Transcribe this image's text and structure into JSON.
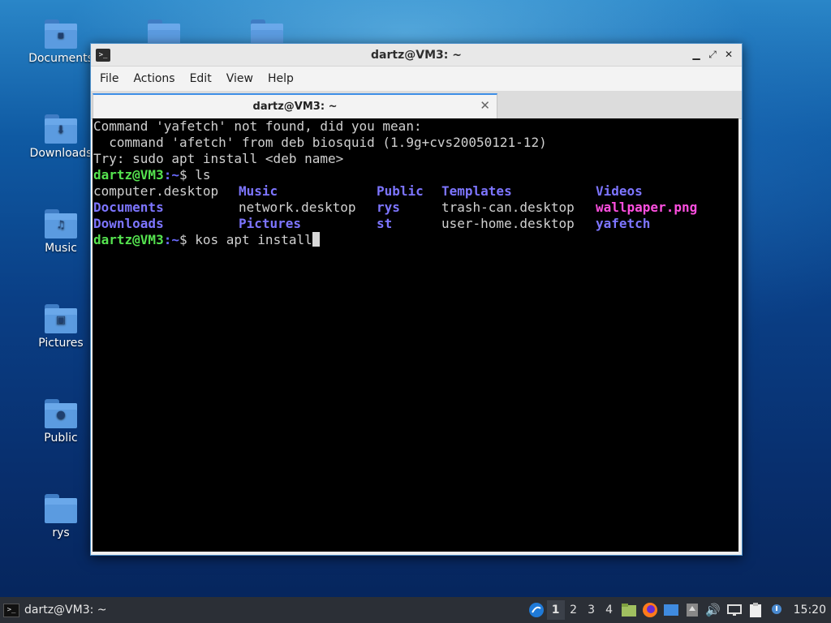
{
  "desktop": {
    "icons": [
      {
        "label": "Documents",
        "glyph": "▪"
      },
      {
        "label": "Downloads",
        "glyph": "⬇"
      },
      {
        "label": "Music",
        "glyph": "♫"
      },
      {
        "label": "Pictures",
        "glyph": "▣"
      },
      {
        "label": "Public",
        "glyph": "●"
      },
      {
        "label": "rys",
        "glyph": ""
      }
    ]
  },
  "window": {
    "title": "dartz@VM3: ~",
    "menu": [
      "File",
      "Actions",
      "Edit",
      "View",
      "Help"
    ],
    "tab_label": "dartz@VM3: ~",
    "terminal": {
      "lines": [
        "Command 'yafetch' not found, did you mean:",
        "  command 'afetch' from deb biosquid (1.9g+cvs20050121-12)",
        "Try: sudo apt install <deb name>"
      ],
      "prompt_user": "dartz@VM3",
      "prompt_path": ":~",
      "prompt_symbol": "$ ",
      "cmd1": "ls",
      "ls_rows": [
        [
          "computer.desktop",
          "Music",
          "Public",
          "Templates",
          "Videos"
        ],
        [
          "Documents",
          "network.desktop",
          "rys",
          "trash-can.desktop",
          "wallpaper.png"
        ],
        [
          "Downloads",
          "Pictures",
          "st",
          "user-home.desktop",
          "yafetch"
        ]
      ],
      "cmd2": "kos apt install"
    }
  },
  "taskbar": {
    "task_label": "dartz@VM3: ~",
    "workspaces": [
      "1",
      "2",
      "3",
      "4"
    ],
    "clock": "15:20"
  }
}
